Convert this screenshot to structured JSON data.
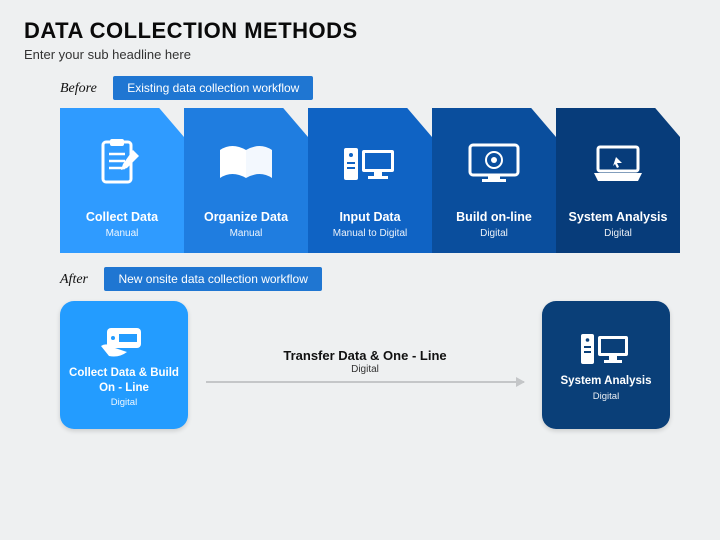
{
  "header": {
    "title": "DATA COLLECTION METHODS",
    "subheadline": "Enter your sub headline here"
  },
  "before": {
    "label": "Before",
    "pill": "Existing data collection workflow",
    "cards": [
      {
        "title": "Collect Data",
        "sub": "Manual",
        "icon": "clipboard-pencil-icon",
        "bg": "#2f9bff"
      },
      {
        "title": "Organize Data",
        "sub": "Manual",
        "icon": "open-book-icon",
        "bg": "#1f7de0"
      },
      {
        "title": "Input Data",
        "sub": "Manual to Digital",
        "icon": "server-monitor-icon",
        "bg": "#0f63c4"
      },
      {
        "title": "Build on-line",
        "sub": "Digital",
        "icon": "monitor-target-icon",
        "bg": "#0a4e9d"
      },
      {
        "title": "System Analysis",
        "sub": "Digital",
        "icon": "laptop-cursor-icon",
        "bg": "#073c7a"
      }
    ]
  },
  "after": {
    "label": "After",
    "pill": "New onsite data collection workflow",
    "left": {
      "title": "Collect Data & Build On - Line",
      "sub": "Digital",
      "icon": "phone-hand-icon",
      "bg": "#239cff"
    },
    "mid": {
      "title": "Transfer Data & One - Line",
      "sub": "Digital"
    },
    "right": {
      "title": "System Analysis",
      "sub": "Digital",
      "icon": "server-monitor-icon",
      "bg": "#0a3f78"
    }
  }
}
